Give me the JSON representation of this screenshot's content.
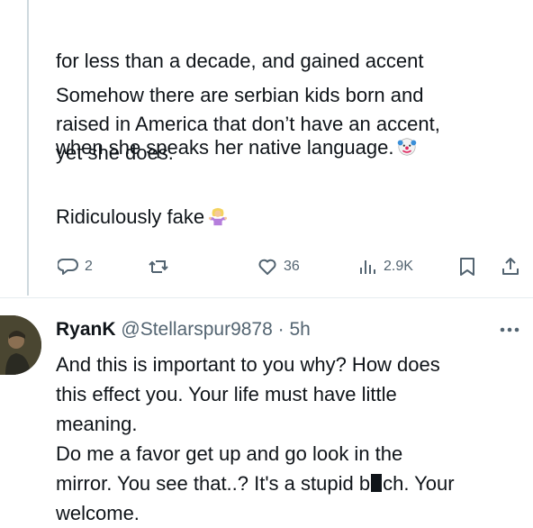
{
  "original_post": {
    "lines": [
      "for less than a decade, and gained accent",
      "when she speaks her native language."
    ],
    "paragraph2": "Somehow there are serbian kids born and\nraised in America that don’t have an accent,\nyet she does.",
    "paragraph3": "Ridiculously fake",
    "emoji_1": "clown-face-icon",
    "emoji_2": "person-shrugging-icon",
    "actions": {
      "replies": "2",
      "reposts": "",
      "likes": "36",
      "views": "2.9K"
    }
  },
  "reply": {
    "name": "RyanK",
    "handle": "@Stellarspur9878",
    "separator": "·",
    "time": "5h",
    "line1": "And this is important to you why? How does",
    "line2": "this effect you. Your life must have little",
    "line3": "meaning.",
    "line4": "Do me a favor get up and go look in the",
    "line5_before": "mirror. You see that..? It's a stupid b",
    "line5_after": "ch. Your",
    "line6": "welcome."
  },
  "colors": {
    "text": "#0f1419",
    "muted": "#536471",
    "divider": "#e6ecf0",
    "thread_line": "#cfd9de"
  }
}
